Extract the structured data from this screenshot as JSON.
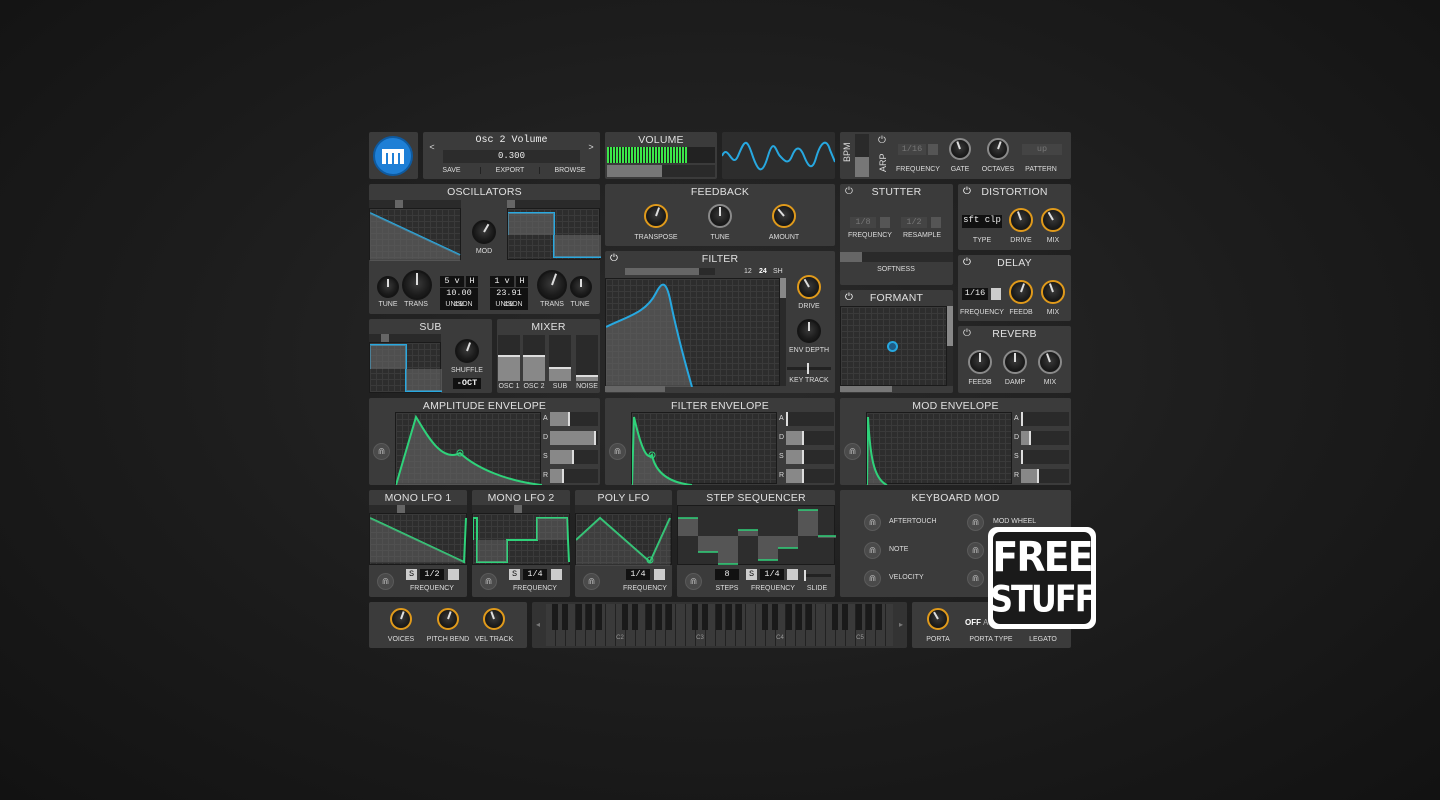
{
  "preset": {
    "name": "Osc 2 Volume",
    "value": "0.300",
    "prev": "<",
    "next": ">",
    "save": "SAVE",
    "export": "EXPORT",
    "browse": "BROWSE"
  },
  "volume": {
    "title": "VOLUME"
  },
  "bpm": {
    "label": "BPM"
  },
  "arp": {
    "label": "ARP",
    "freq_val": "1/16",
    "pattern_val": "up",
    "frequency": "FREQUENCY",
    "gate": "GATE",
    "octaves": "OCTAVES",
    "pattern": "PATTERN"
  },
  "oscillators": {
    "title": "OSCILLATORS",
    "mod": "MOD",
    "tune1": "TUNE",
    "trans1": "TRANS",
    "unison1_voices": "5 v",
    "unison1_h": "H",
    "unison1_detune": "10.00 ce",
    "unison1": "UNISON",
    "unison2_voices": "1 v",
    "unison2_h": "H",
    "unison2_detune": "23.91 ce",
    "unison2": "UNISON",
    "trans2": "TRANS",
    "tune2": "TUNE"
  },
  "feedback": {
    "title": "FEEDBACK",
    "transpose": "TRANSPOSE",
    "tune": "TUNE",
    "amount": "AMOUNT"
  },
  "stutter": {
    "title": "STUTTER",
    "freq_val": "1/8",
    "resample_val": "1/2",
    "frequency": "FREQUENCY",
    "resample": "RESAMPLE",
    "softness": "SOFTNESS"
  },
  "distortion": {
    "title": "DISTORTION",
    "type_val": "sft clp",
    "type": "TYPE",
    "drive": "DRIVE",
    "mix": "MIX"
  },
  "filter": {
    "title": "FILTER",
    "db12": "12",
    "db24": "24",
    "sh": "SH",
    "drive": "DRIVE",
    "env_depth": "ENV DEPTH",
    "key_track": "KEY TRACK"
  },
  "delay": {
    "title": "DELAY",
    "freq_val": "1/16",
    "frequency": "FREQUENCY",
    "feedb": "FEEDB",
    "mix": "MIX"
  },
  "formant": {
    "title": "FORMANT"
  },
  "reverb": {
    "title": "REVERB",
    "feedb": "FEEDB",
    "damp": "DAMP",
    "mix": "MIX"
  },
  "sub": {
    "title": "SUB",
    "shuffle": "SHUFFLE",
    "oct": "-OCT"
  },
  "mixer": {
    "title": "MIXER",
    "osc1": "OSC 1",
    "osc2": "OSC 2",
    "sub": "SUB",
    "noise": "NOISE"
  },
  "amp_env": {
    "title": "AMPLITUDE ENVELOPE",
    "a": "A",
    "d": "D",
    "s": "S",
    "r": "R"
  },
  "filter_env": {
    "title": "FILTER ENVELOPE",
    "a": "A",
    "d": "D",
    "s": "S",
    "r": "R"
  },
  "mod_env": {
    "title": "MOD ENVELOPE",
    "a": "A",
    "d": "D",
    "s": "S",
    "r": "R"
  },
  "lfo1": {
    "title": "MONO LFO 1",
    "s": "S",
    "val": "1/2",
    "frequency": "FREQUENCY"
  },
  "lfo2": {
    "title": "MONO LFO 2",
    "s": "S",
    "val": "1/4",
    "frequency": "FREQUENCY"
  },
  "polylfo": {
    "title": "POLY LFO",
    "val": "1/4",
    "frequency": "FREQUENCY"
  },
  "stepseq": {
    "title": "STEP SEQUENCER",
    "steps_val": "8",
    "s": "S",
    "freq_val": "1/4",
    "steps": "STEPS",
    "frequency": "FREQUENCY",
    "slide": "SLIDE"
  },
  "keymod": {
    "title": "KEYBOARD MOD",
    "aftertouch": "AFTERTOUCH",
    "mod_wheel": "MOD WHEEL",
    "note": "NOTE",
    "velocity": "VELOCITY"
  },
  "bottom": {
    "voices": "VOICES",
    "pitch_bend": "PITCH BEND",
    "vel_track": "VEL TRACK",
    "porta": "PORTA",
    "porta_type_val": "OFF",
    "porta_type_extra": "A",
    "porta_type": "PORTA TYPE",
    "legato": "LEGATO"
  },
  "keyboard": {
    "c2": "C2",
    "c3": "C3",
    "c4": "C4",
    "c5": "C5"
  },
  "badge": {
    "line1": "FREE",
    "line2": "STUFF"
  },
  "colors": {
    "accent_blue": "#27a8e0",
    "accent_green": "#2fd27a",
    "accent_gold": "#e09a1b",
    "panel": "#3b3b3b"
  }
}
